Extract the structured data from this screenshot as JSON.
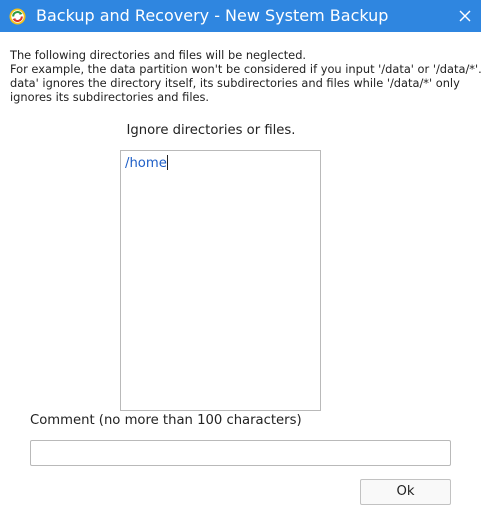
{
  "window": {
    "title": "Backup and Recovery - New System Backup",
    "icon": "backup-app-icon",
    "close_icon": "close-icon",
    "accent_color": "#2f86e0"
  },
  "intro": {
    "lines": [
      "The following directories and files will be neglected.",
      "For example, the data partition won't be considered if you input '/data' or '/data/*'. '/",
      "data' ignores the directory itself, its subdirectories and files while '/data/*' only",
      "ignores its subdirectories and files."
    ]
  },
  "ignore": {
    "label": "Ignore directories or files.",
    "value": "/home",
    "text_color": "#1f5fc7"
  },
  "comment": {
    "label": "Comment (no more than 100 characters)",
    "value": ""
  },
  "buttons": {
    "ok_label": "Ok"
  }
}
